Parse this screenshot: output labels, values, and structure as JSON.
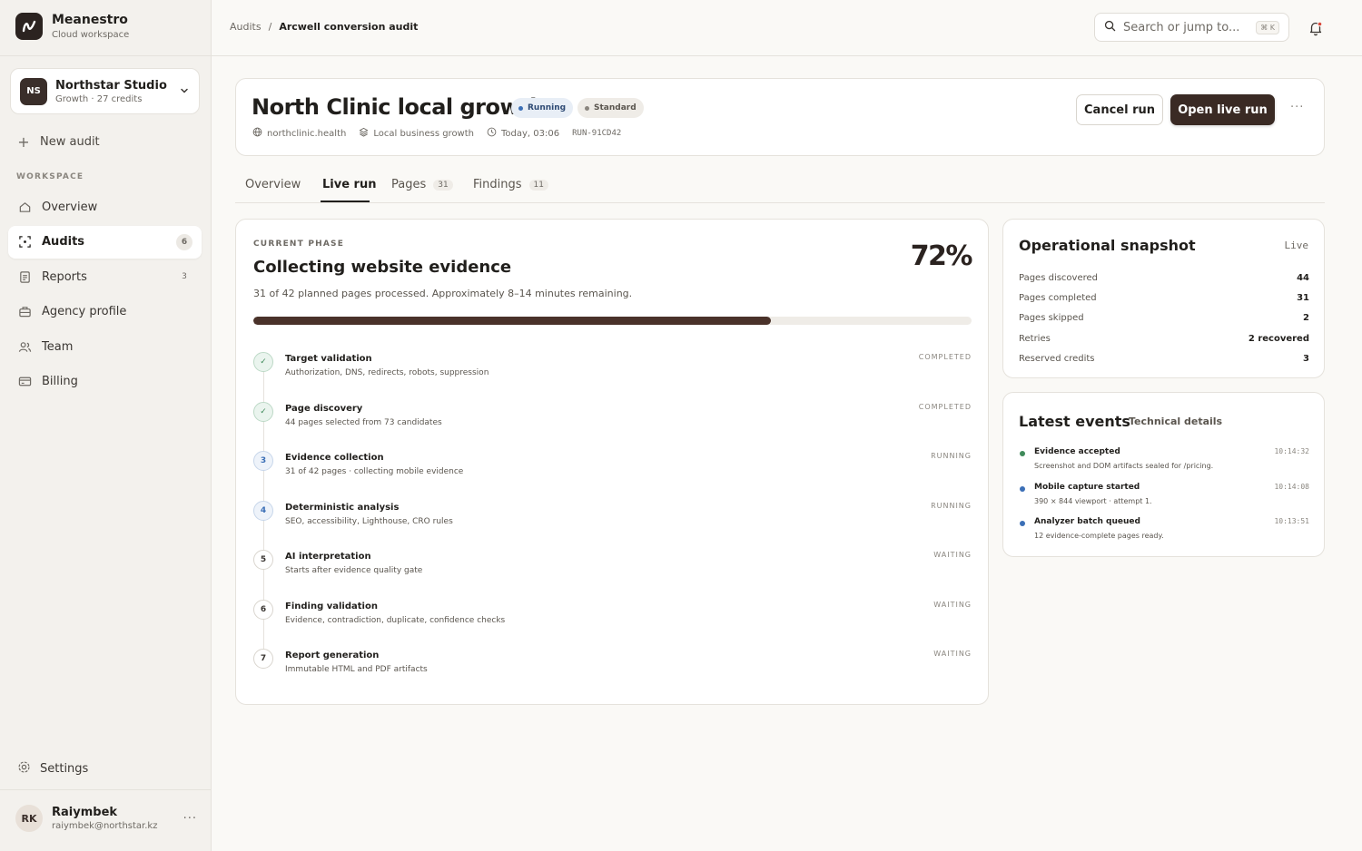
{
  "brand": {
    "name": "Meanestro",
    "subtitle": "Cloud workspace"
  },
  "workspace": {
    "initials": "NS",
    "name": "Northstar Studio",
    "plan": "Growth · 27 credits"
  },
  "sidebar": {
    "new_audit": "New audit",
    "section_label": "WORKSPACE",
    "items": [
      {
        "label": "Overview",
        "icon": "home-icon",
        "count": ""
      },
      {
        "label": "Audits",
        "icon": "audit-icon",
        "count": "6",
        "active": true
      },
      {
        "label": "Reports",
        "icon": "report-icon",
        "count": "3"
      },
      {
        "label": "Agency profile",
        "icon": "briefcase-icon",
        "count": ""
      },
      {
        "label": "Team",
        "icon": "team-icon",
        "count": ""
      },
      {
        "label": "Billing",
        "icon": "card-icon",
        "count": ""
      }
    ],
    "settings": "Settings"
  },
  "user": {
    "initials": "RK",
    "name": "Raiymbek",
    "email": "raiymbek@northstar.kz"
  },
  "topbar": {
    "breadcrumb_root": "Audits",
    "breadcrumb_sep": "/",
    "breadcrumb_current": "Arcwell conversion audit",
    "search_placeholder": "Search or jump to...",
    "search_shortcut": "⌘ K"
  },
  "header": {
    "title": "North Clinic local growth",
    "status_badge": "Running",
    "tier_badge": "Standard",
    "domain": "northclinic.health",
    "type": "Local business growth",
    "time": "Today, 03:06",
    "run_id": "RUN-91CD42",
    "cancel_label": "Cancel run",
    "open_label": "Open live run",
    "more": "···"
  },
  "tabs": [
    {
      "label": "Overview",
      "count": ""
    },
    {
      "label": "Live run",
      "count": "",
      "active": true
    },
    {
      "label": "Pages",
      "count": "31"
    },
    {
      "label": "Findings",
      "count": "11"
    }
  ],
  "phase": {
    "label": "CURRENT PHASE",
    "title": "Collecting website evidence",
    "description": "31 of 42 planned pages processed. Approximately 8–14 minutes remaining.",
    "percent_label": "72%",
    "progress": 0.72
  },
  "steps": [
    {
      "marker": "✓",
      "state": "done",
      "name": "Target validation",
      "desc": "Authorization, DNS, redirects, robots, suppression",
      "status": "COMPLETED"
    },
    {
      "marker": "✓",
      "state": "done",
      "name": "Page discovery",
      "desc": "44 pages selected from 73 candidates",
      "status": "COMPLETED"
    },
    {
      "marker": "3",
      "state": "running",
      "name": "Evidence collection",
      "desc": "31 of 42 pages · collecting mobile evidence",
      "status": "RUNNING"
    },
    {
      "marker": "4",
      "state": "running",
      "name": "Deterministic analysis",
      "desc": "SEO, accessibility, Lighthouse, CRO rules",
      "status": "RUNNING"
    },
    {
      "marker": "5",
      "state": "waiting",
      "name": "AI interpretation",
      "desc": "Starts after evidence quality gate",
      "status": "WAITING"
    },
    {
      "marker": "6",
      "state": "waiting",
      "name": "Finding validation",
      "desc": "Evidence, contradiction, duplicate, confidence checks",
      "status": "WAITING"
    },
    {
      "marker": "7",
      "state": "waiting",
      "name": "Report generation",
      "desc": "Immutable HTML and PDF artifacts",
      "status": "WAITING"
    }
  ],
  "snapshot": {
    "title": "Operational snapshot",
    "live": "Live",
    "rows": [
      {
        "label": "Pages discovered",
        "value": "44"
      },
      {
        "label": "Pages completed",
        "value": "31"
      },
      {
        "label": "Pages skipped",
        "value": "2"
      },
      {
        "label": "Retries",
        "value": "2 recovered"
      },
      {
        "label": "Reserved credits",
        "value": "3"
      }
    ]
  },
  "events": {
    "title": "Latest events",
    "tech_link": "Technical details",
    "items": [
      {
        "name": "Evidence accepted",
        "desc": "Screenshot and DOM artifacts sealed for /pricing.",
        "time": "10:14:32",
        "color": "#3f8a5a"
      },
      {
        "name": "Mobile capture started",
        "desc": "390 × 844 viewport · attempt 1.",
        "time": "10:14:08",
        "color": "#3b6fb6"
      },
      {
        "name": "Analyzer batch queued",
        "desc": "12 evidence-complete pages ready.",
        "time": "10:13:51",
        "color": "#3b6fb6"
      }
    ]
  }
}
